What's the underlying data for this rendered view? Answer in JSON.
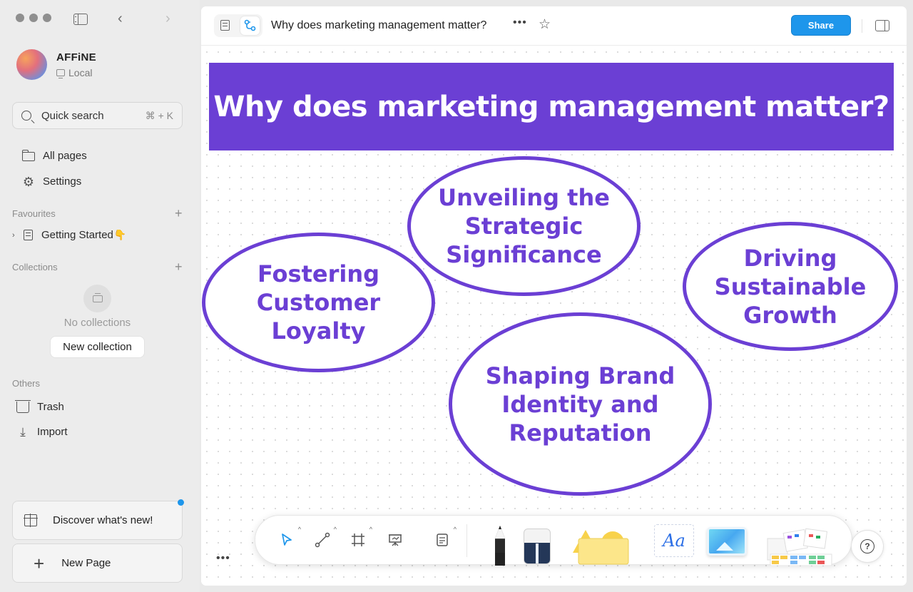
{
  "workspace": {
    "name": "AFFiNE",
    "storage": "Local"
  },
  "search": {
    "label": "Quick search",
    "shortcut": "⌘ + K"
  },
  "nav": {
    "all_pages": "All pages",
    "settings": "Settings"
  },
  "favourites": {
    "title": "Favourites",
    "items": [
      {
        "label": "Getting Started",
        "emoji": "👇"
      }
    ]
  },
  "collections": {
    "title": "Collections",
    "empty_text": "No collections",
    "new_button": "New collection"
  },
  "others": {
    "title": "Others",
    "trash": "Trash",
    "import": "Import"
  },
  "discover": {
    "label": "Discover what's new!"
  },
  "new_page": {
    "label": "New Page"
  },
  "doc": {
    "title": "Why does marketing management matter?"
  },
  "share_button": "Share",
  "canvas": {
    "banner": "Why does marketing management matter?",
    "bubbles": {
      "strategic": "Unveiling the Strategic Significance",
      "loyalty": "Fostering Customer Loyalty",
      "growth": "Driving Sustainable Growth",
      "brand": "Shaping Brand Identity and Reputation"
    }
  },
  "toolbar": {
    "text_tool": "Aa"
  },
  "colors": {
    "accent": "#6b3fd4",
    "brand_blue": "#1e96eb"
  }
}
